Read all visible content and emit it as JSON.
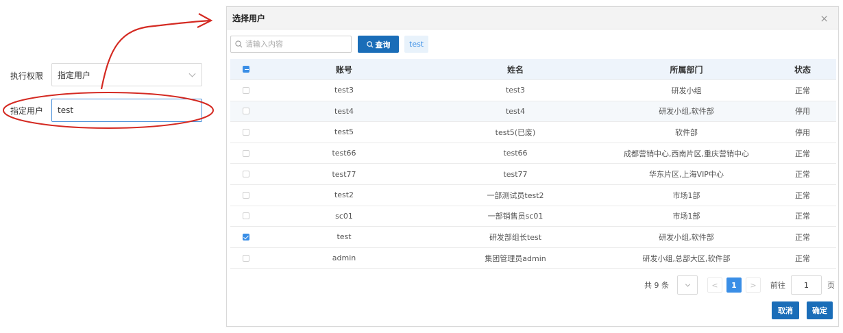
{
  "form": {
    "perm_label": "执行权限",
    "perm_value": "指定用户",
    "user_label": "指定用户",
    "user_value": "test"
  },
  "dialog": {
    "title": "选择用户",
    "close": "×",
    "search_placeholder": "请输入内容",
    "query_label": "查询",
    "selected_tag": "test",
    "columns": [
      "账号",
      "姓名",
      "所属部门",
      "状态"
    ],
    "rows": [
      {
        "account": "test3",
        "name": "test3",
        "dept": "研发小组",
        "status": "正常",
        "checked": false
      },
      {
        "account": "test4",
        "name": "test4",
        "dept": "研发小组,软件部",
        "status": "停用",
        "checked": false
      },
      {
        "account": "test5",
        "name": "test5(已废)",
        "dept": "软件部",
        "status": "停用",
        "checked": false
      },
      {
        "account": "test66",
        "name": "test66",
        "dept": "成都营销中心,西南片区,重庆营销中心",
        "status": "正常",
        "checked": false
      },
      {
        "account": "test77",
        "name": "test77",
        "dept": "华东片区,上海VIP中心",
        "status": "正常",
        "checked": false
      },
      {
        "account": "test2",
        "name": "一部测试员test2",
        "dept": "市场1部",
        "status": "正常",
        "checked": false
      },
      {
        "account": "sc01",
        "name": "一部销售员sc01",
        "dept": "市场1部",
        "status": "正常",
        "checked": false
      },
      {
        "account": "test",
        "name": "研发部组长test",
        "dept": "研发小组,软件部",
        "status": "正常",
        "checked": true
      },
      {
        "account": "admin",
        "name": "集团管理员admin",
        "dept": "研发小组,总部大区,软件部",
        "status": "正常",
        "checked": false
      }
    ],
    "pager": {
      "total": "共 9 条",
      "prev": "<",
      "current": "1",
      "next": ">",
      "goto": "前往",
      "page_value": "1",
      "page_suffix": "页"
    },
    "cancel_label": "取消",
    "confirm_label": "确定"
  },
  "colors": {
    "primary": "#1a6db8",
    "accent": "#3a8ee6",
    "annotation": "#d42a22"
  }
}
